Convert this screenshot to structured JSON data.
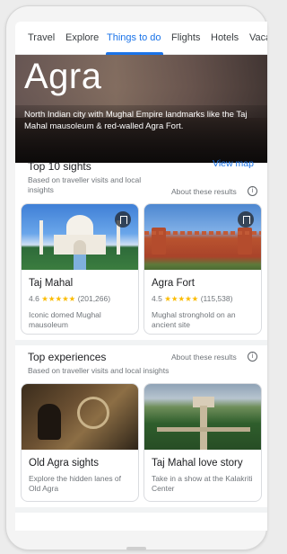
{
  "tabs": [
    "Travel",
    "Explore",
    "Things to do",
    "Flights",
    "Hotels",
    "Vaca"
  ],
  "active_tab": "Things to do",
  "hero": {
    "title": "Agra",
    "description": "North Indian city with Mughal Empire landmarks like the Taj Mahal mausoleum & red-walled Agra Fort."
  },
  "sights": {
    "heading": "Top 10 sights",
    "subtitle": "Based on traveller visits and local insights",
    "view_map": "View map",
    "about": "About these results",
    "cards": [
      {
        "title": "Taj Mahal",
        "rating": "4.6",
        "stars": "★★★★★",
        "reviews": "(201,266)",
        "description": "Iconic domed Mughal mausoleum",
        "image_icon": "taj-mahal-photo"
      },
      {
        "title": "Agra Fort",
        "rating": "4.5",
        "stars": "★★★★★",
        "reviews": "(115,538)",
        "description": "Mughal stronghold on an ancient site",
        "image_icon": "agra-fort-photo"
      }
    ]
  },
  "experiences": {
    "heading": "Top experiences",
    "subtitle": "Based on traveller visits and local insights",
    "about": "About these results",
    "cards": [
      {
        "title": "Old Agra sights",
        "description": "Explore the hidden lanes of Old Agra",
        "image_icon": "rickshaw-photo"
      },
      {
        "title": "Taj Mahal love story",
        "description": "Take in a show at the Kalakriti Center",
        "image_icon": "garden-aerial-photo"
      }
    ]
  },
  "colors": {
    "accent": "#1a73e8",
    "star": "#fbbc04",
    "secondary_text": "#70757a"
  }
}
